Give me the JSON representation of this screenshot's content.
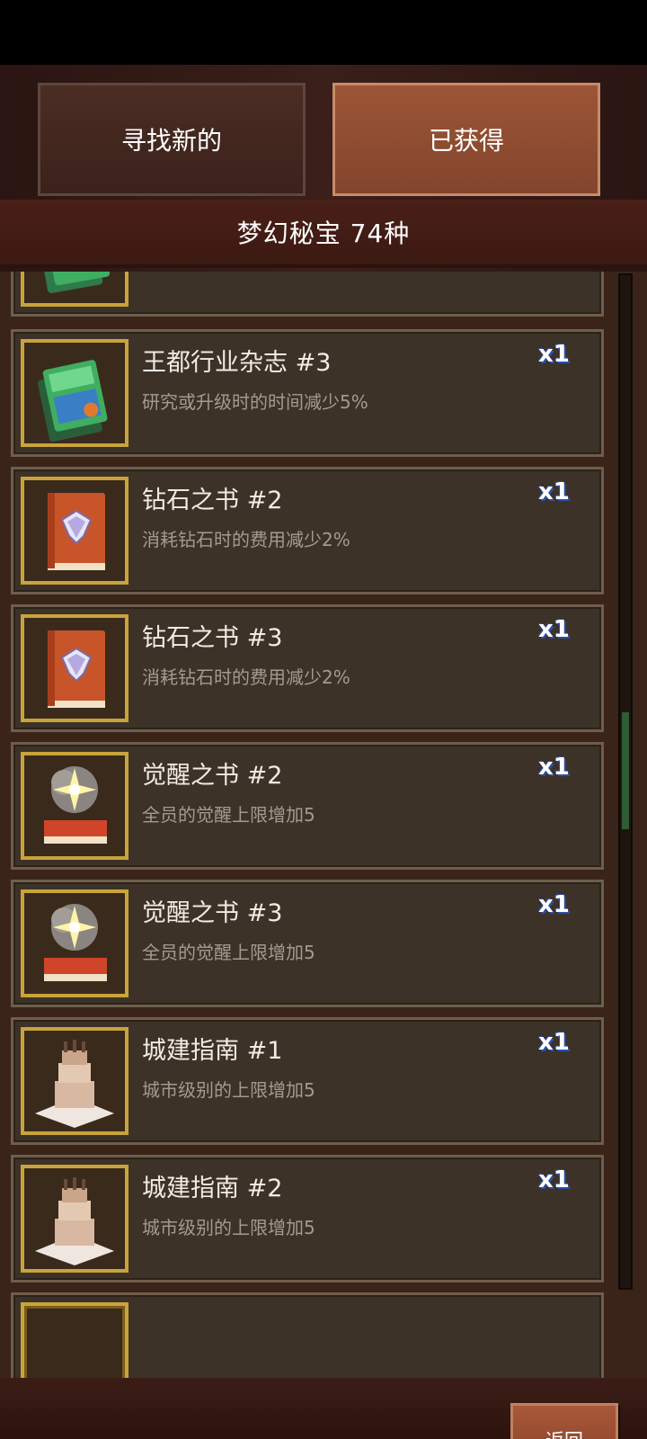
{
  "tabs": {
    "find": "寻找新的",
    "owned": "已获得"
  },
  "header": {
    "title": "梦幻秘宝 74种"
  },
  "items": [
    {
      "title": "王都行业杂志 #3",
      "desc": "研究或升级时的时间减少5%",
      "qty": "x1",
      "icon": "magazine-icon"
    },
    {
      "title": "钻石之书 #2",
      "desc": "消耗钻石时的费用减少2%",
      "qty": "x1",
      "icon": "diamond-book-icon"
    },
    {
      "title": "钻石之书 #3",
      "desc": "消耗钻石时的费用减少2%",
      "qty": "x1",
      "icon": "diamond-book-icon"
    },
    {
      "title": "觉醒之书 #2",
      "desc": "全员的觉醒上限增加5",
      "qty": "x1",
      "icon": "awakening-book-icon"
    },
    {
      "title": "觉醒之书 #3",
      "desc": "全员的觉醒上限增加5",
      "qty": "x1",
      "icon": "awakening-book-icon"
    },
    {
      "title": "城建指南 #1",
      "desc": "城市级别的上限增加5",
      "qty": "x1",
      "icon": "city-guide-icon"
    },
    {
      "title": "城建指南 #2",
      "desc": "城市级别的上限增加5",
      "qty": "x1",
      "icon": "city-guide-icon"
    }
  ],
  "back": {
    "label": "返回"
  }
}
